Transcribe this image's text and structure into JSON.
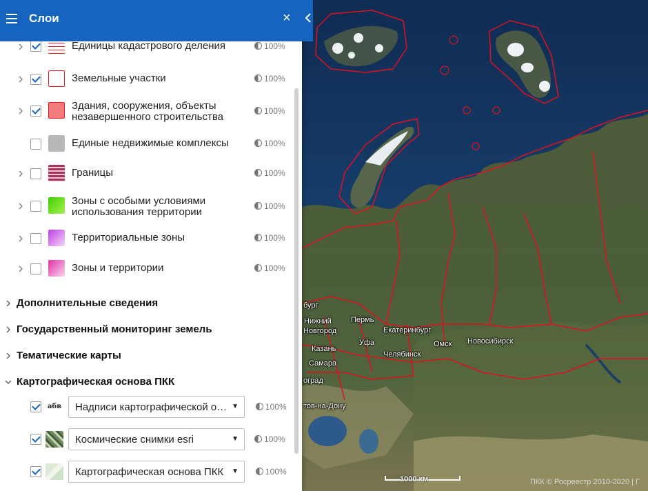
{
  "panel": {
    "title": "Слои",
    "close_label": "×"
  },
  "layers": [
    {
      "label": "Единицы кадастрового деления",
      "opacity": "100%",
      "checked": true
    },
    {
      "label": "Земельные участки",
      "opacity": "100%",
      "checked": true
    },
    {
      "label_lines": [
        "Здания, сооружения, объекты",
        "незавершенного строительства"
      ],
      "opacity": "100%",
      "checked": true
    },
    {
      "label": "Единые недвижимые комплексы",
      "opacity": "100%",
      "checked": false
    },
    {
      "label": "Границы",
      "opacity": "100%",
      "checked": false
    },
    {
      "label_lines": [
        "Зоны с особыми условиями",
        "использования территории"
      ],
      "opacity": "100%",
      "checked": false
    },
    {
      "label": "Территориальные зоны",
      "opacity": "100%",
      "checked": false
    },
    {
      "label": "Зоны и территории",
      "opacity": "100%",
      "checked": false
    }
  ],
  "sections": [
    {
      "title": "Дополнительные сведения",
      "expanded": false
    },
    {
      "title": "Государственный мониторинг земель",
      "expanded": false
    },
    {
      "title": "Тематические карты",
      "expanded": false
    },
    {
      "title": "Картографическая основа ПКК",
      "expanded": true
    }
  ],
  "base_layers": [
    {
      "icon_text": "абв",
      "value": "Надписи картографической основы",
      "opacity": "100%",
      "checked": true
    },
    {
      "value": "Космические снимки esri",
      "opacity": "100%",
      "checked": true
    },
    {
      "value": "Картографическая основа ПКК",
      "opacity": "100%",
      "checked": true
    }
  ],
  "map": {
    "cities": [
      "бург",
      "Нижний",
      "Новгород",
      "Пермь",
      "Екатеринбург",
      "Казань",
      "Уфа",
      "Омск",
      "Новосибирск",
      "Челябинск",
      "Самара",
      "оград",
      "тов-на-Дону"
    ],
    "scale_label": "1000 км",
    "attribution": "ПКК © Росреестр 2010-2020 | Г"
  },
  "colors": {
    "header": "#1565c0",
    "boundary": "#e01020"
  }
}
